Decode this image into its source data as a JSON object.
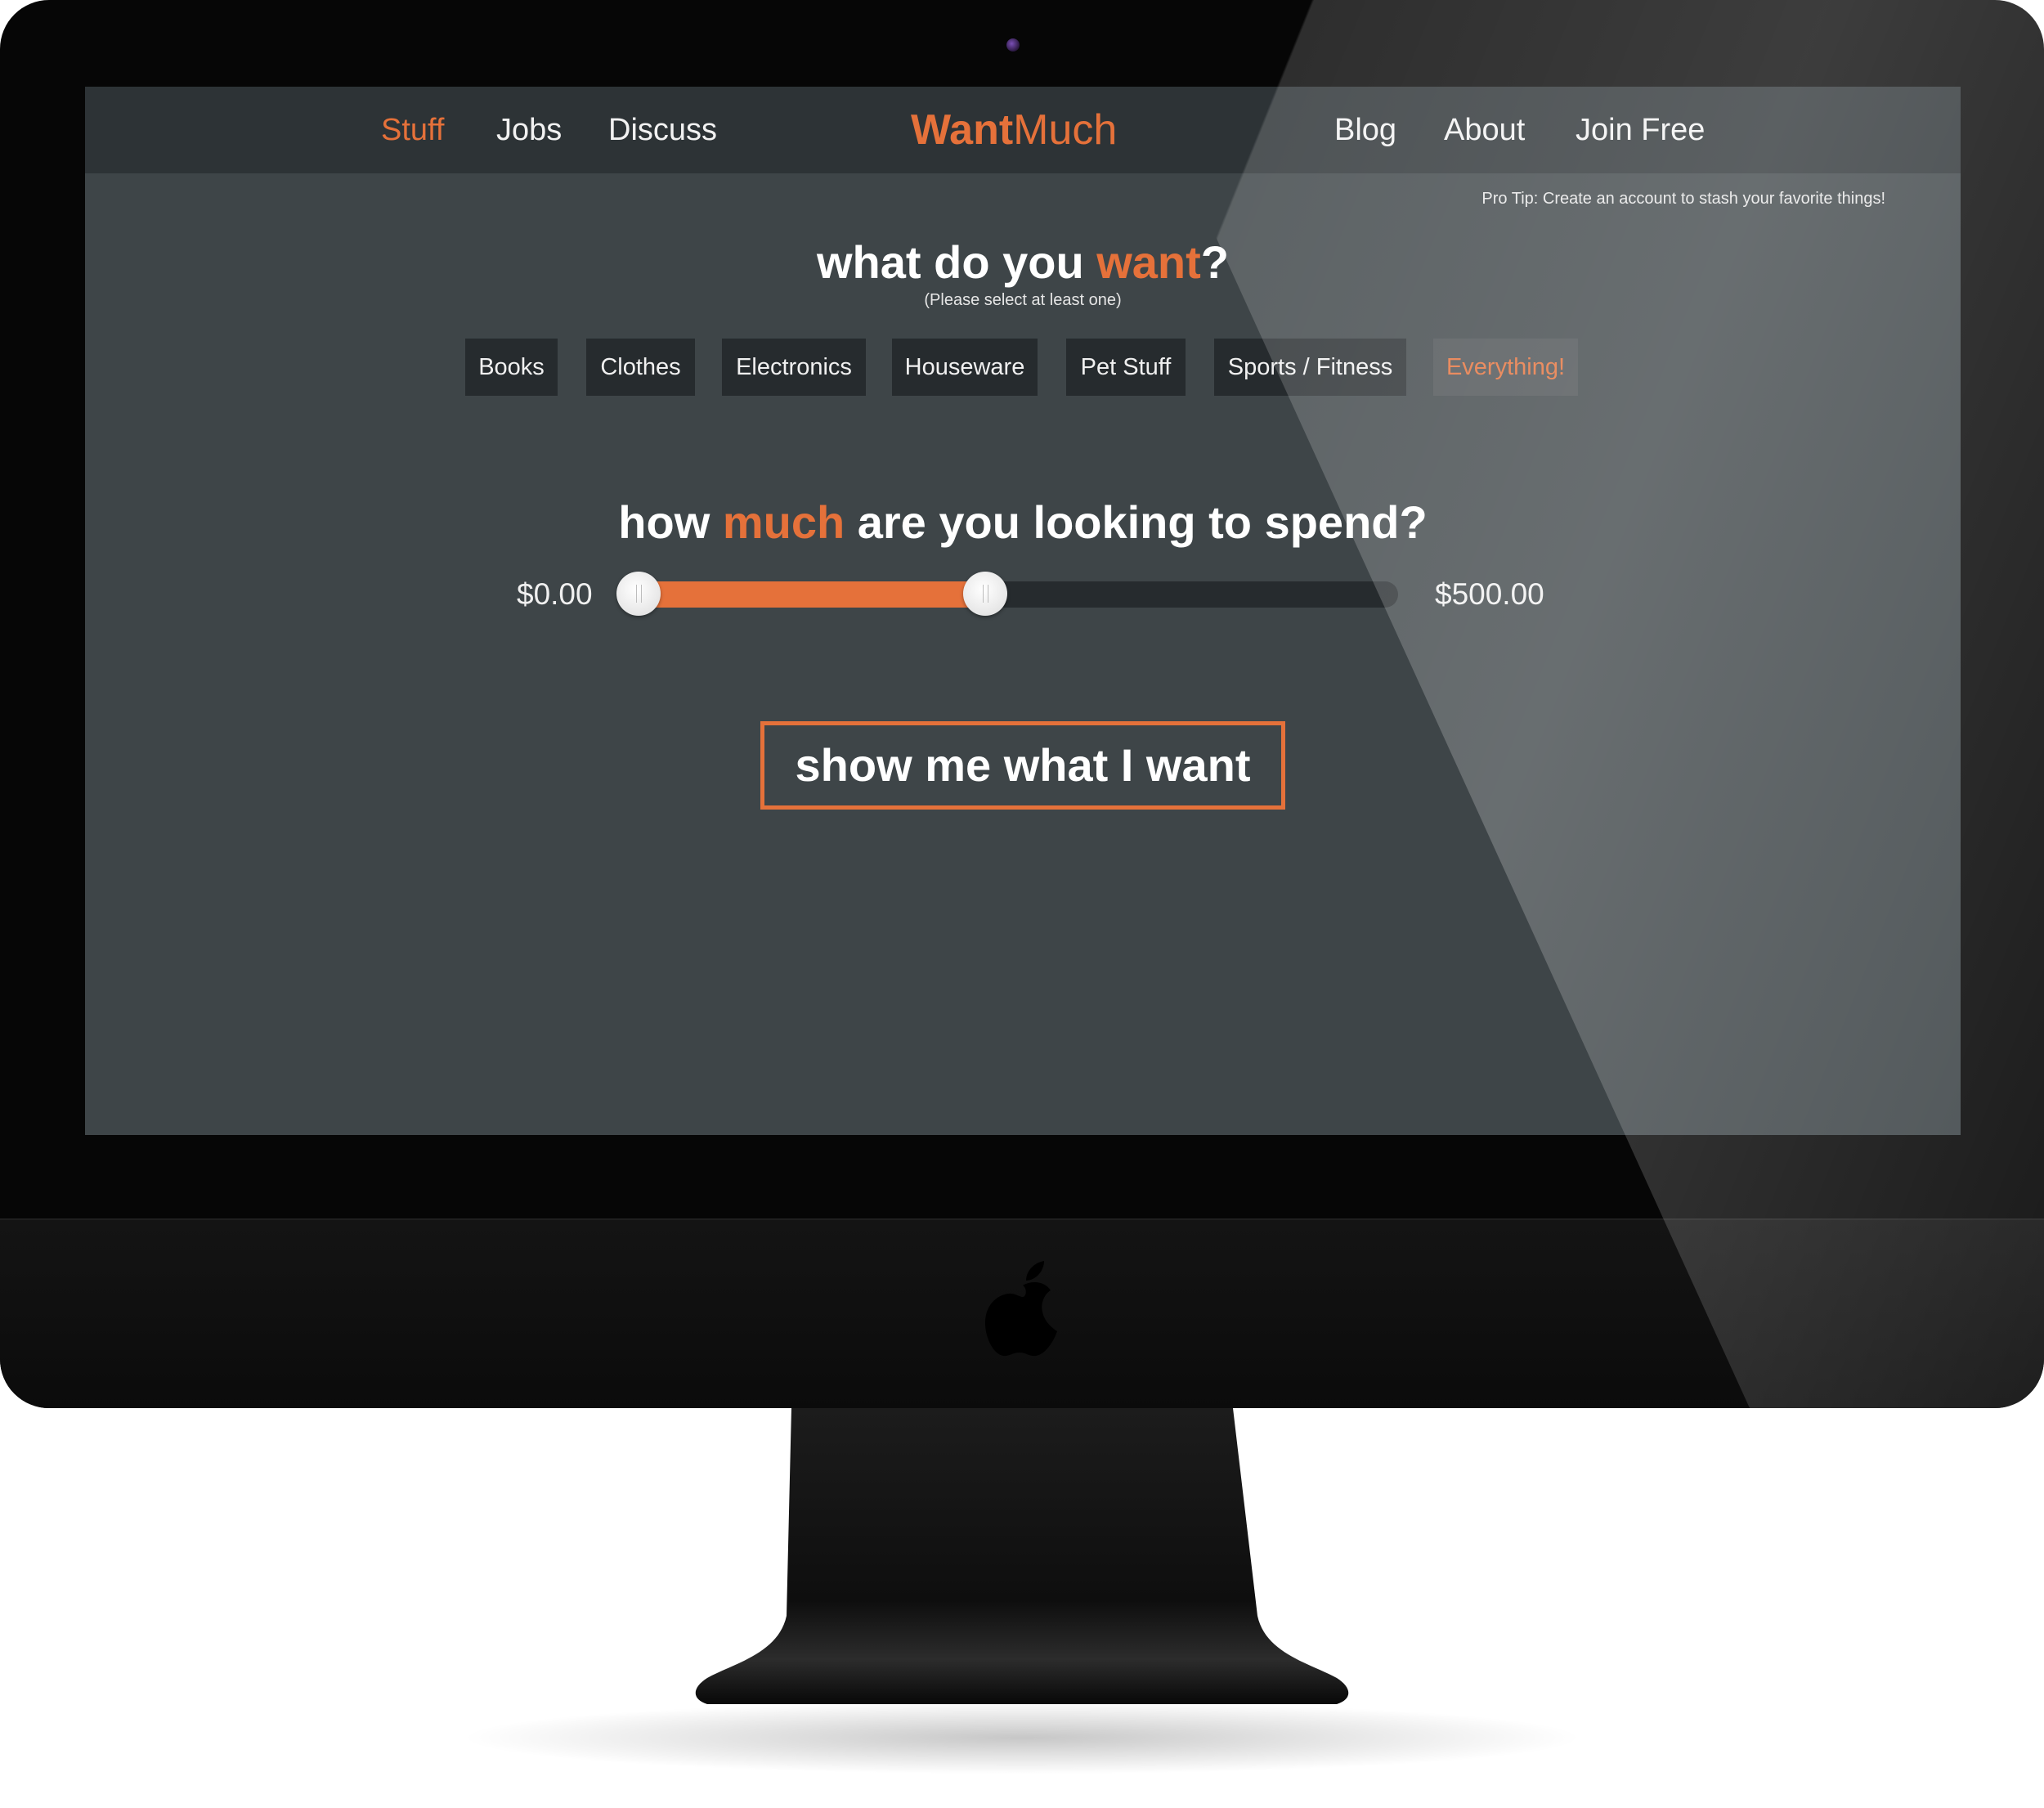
{
  "nav": {
    "left_items": [
      {
        "label": "Stuff",
        "active": true
      },
      {
        "label": "Jobs",
        "active": false
      },
      {
        "label": "Discuss",
        "active": false
      }
    ],
    "logo": {
      "part_a": "Want",
      "part_b": "Much"
    },
    "right_items": [
      {
        "label": "Blog"
      },
      {
        "label": "About"
      },
      {
        "label": "Join Free"
      }
    ]
  },
  "pro_tip": "Pro Tip: Create an account to stash your favorite things!",
  "question1": {
    "before": "what do you ",
    "accent": "want",
    "after": "?",
    "note": "(Please select at least one)"
  },
  "categories": [
    {
      "label": "Books",
      "selected": false
    },
    {
      "label": "Clothes",
      "selected": false
    },
    {
      "label": "Electronics",
      "selected": false
    },
    {
      "label": "Houseware",
      "selected": false
    },
    {
      "label": "Pet Stuff",
      "selected": false
    },
    {
      "label": "Sports / Fitness",
      "selected": false
    },
    {
      "label": "Everything!",
      "selected": true
    }
  ],
  "question2": {
    "before": "how ",
    "accent": "much",
    "after": " are you looking to spend?"
  },
  "price_range": {
    "min_label": "$0.00",
    "max_label": "$500.00",
    "low_fraction": 0.0,
    "high_fraction": 0.47
  },
  "cta_label": "show me what I want",
  "colors": {
    "accent": "#e5713a",
    "screen_bg": "#3e4548",
    "navbar_bg": "#2d3336",
    "chip_bg": "#262b2e"
  },
  "icons": {
    "camera": "camera-icon",
    "apple": "apple-logo-icon"
  }
}
